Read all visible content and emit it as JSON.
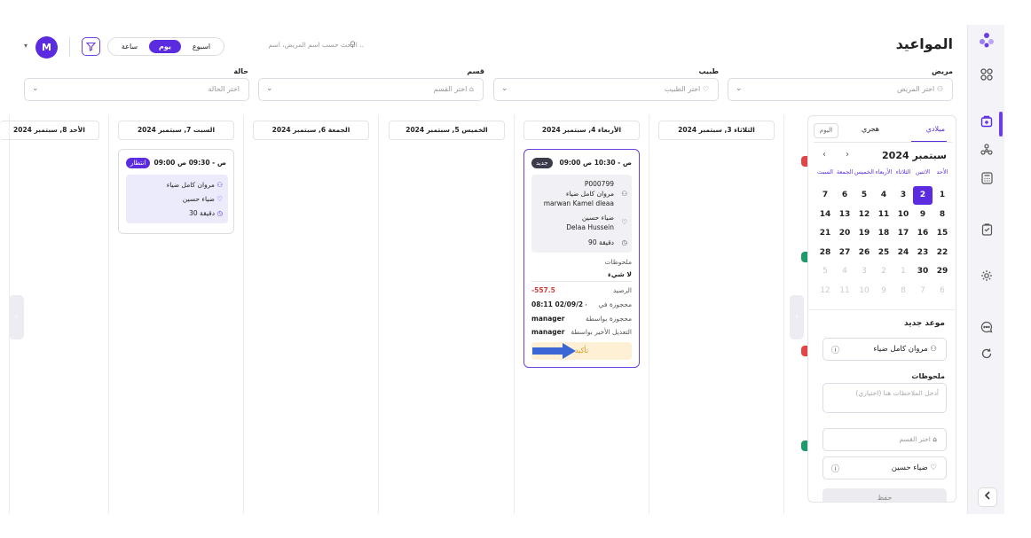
{
  "header": {
    "title": "المواعيد",
    "avatar_initial": "M",
    "view_options": [
      "اسبوع",
      "يوم",
      "ساعة"
    ],
    "active_view": "يوم",
    "search_placeholder": "البحث حسب اسم المريض، اسم .."
  },
  "filters": [
    {
      "label": "مريض",
      "placeholder": "اختر المريض",
      "icon": "user-icon"
    },
    {
      "label": "طبيب",
      "placeholder": "اختر الطبيب",
      "icon": "stethoscope-icon"
    },
    {
      "label": "قسم",
      "placeholder": "اختر القسم",
      "icon": "building-icon"
    },
    {
      "label": "حالة",
      "placeholder": "اختر الحالة",
      "icon": ""
    }
  ],
  "days": [
    "الأحد 8, سبتمبر 2024",
    "السبت 7, سبتمبر 2024",
    "الجمعة 6, سبتمبر 2024",
    "الخميس 5, سبتمبر 2024",
    "الأربعاء 4, سبتمبر 2024",
    "الثلاثاء 3, سبتمبر 2024"
  ],
  "appointment_saturday": {
    "time": "09:00 ص - 09:30 ص",
    "status": "انتظار",
    "status_color": "#5b2be0",
    "patient": "مروان كامل ضياء",
    "doctor": "ضياء حسين",
    "duration": "30 دقيقة"
  },
  "appointment_wednesday": {
    "time": "09:00 ص - 10:30 ص",
    "status": "جديد",
    "status_color": "#3b3b4a",
    "patient_id": "P000799",
    "patient_ar": "مروان كامل ضياء",
    "patient_en": "marwan Kamel dleaa",
    "doctor_ar": "ضياء حسين",
    "doctor_en": "Delaa Hussein",
    "duration": "90 دقيقة",
    "notes_label": "ملحوظات",
    "notes_value": "لا شيء",
    "balance_label": "الرصيد",
    "balance_value": "-557.5",
    "booked_at_label": "محجوزة في",
    "booked_at_value": "08:11 م - 02/09/2...",
    "booked_by_label": "محجوزة بواسطة",
    "booked_by_value": "manager",
    "modified_by_label": "التعديل الأخير بواسطة",
    "modified_by_value": "manager",
    "confirm_label": "تأكيد"
  },
  "calendar": {
    "tabs": [
      "ميلادي",
      "هجري",
      "اليوم"
    ],
    "month_label": "سبتمبر 2024",
    "weekdays": [
      "الأحد",
      "الاثنين",
      "الثلاثاء",
      "الأربعاء",
      "الخميس",
      "الجمعة",
      "السبت"
    ],
    "weeks": [
      [
        {
          "d": "1"
        },
        {
          "d": "2",
          "sel": true
        },
        {
          "d": "3"
        },
        {
          "d": "4"
        },
        {
          "d": "5"
        },
        {
          "d": "6"
        },
        {
          "d": "7"
        }
      ],
      [
        {
          "d": "8"
        },
        {
          "d": "9"
        },
        {
          "d": "10"
        },
        {
          "d": "11"
        },
        {
          "d": "12"
        },
        {
          "d": "13"
        },
        {
          "d": "14"
        }
      ],
      [
        {
          "d": "15"
        },
        {
          "d": "16"
        },
        {
          "d": "17"
        },
        {
          "d": "18"
        },
        {
          "d": "19"
        },
        {
          "d": "20"
        },
        {
          "d": "21"
        }
      ],
      [
        {
          "d": "22"
        },
        {
          "d": "23"
        },
        {
          "d": "24"
        },
        {
          "d": "25"
        },
        {
          "d": "26"
        },
        {
          "d": "27"
        },
        {
          "d": "28"
        }
      ],
      [
        {
          "d": "29"
        },
        {
          "d": "30"
        },
        {
          "d": "1",
          "f": true
        },
        {
          "d": "2",
          "f": true
        },
        {
          "d": "3",
          "f": true
        },
        {
          "d": "4",
          "f": true
        },
        {
          "d": "5",
          "f": true
        }
      ],
      [
        {
          "d": "6",
          "f": true
        },
        {
          "d": "7",
          "f": true
        },
        {
          "d": "8",
          "f": true
        },
        {
          "d": "9",
          "f": true
        },
        {
          "d": "10",
          "f": true
        },
        {
          "d": "11",
          "f": true
        },
        {
          "d": "12",
          "f": true
        }
      ]
    ]
  },
  "new_appointment": {
    "title": "موعد جديد",
    "patient_value": "مروان كامل ضياء",
    "notes_label": "ملحوظات",
    "notes_placeholder": "أدخل الملاحظات هنا (اختياري)",
    "department_placeholder": "اختر القسم",
    "doctor_value": "ضياء حسين",
    "save_label": "حفظ"
  },
  "colors": {
    "accent": "#5b2be0",
    "confirm_bg": "#fdf0d5",
    "arrow": "#3a66d6",
    "negative": "#d23b3b"
  }
}
